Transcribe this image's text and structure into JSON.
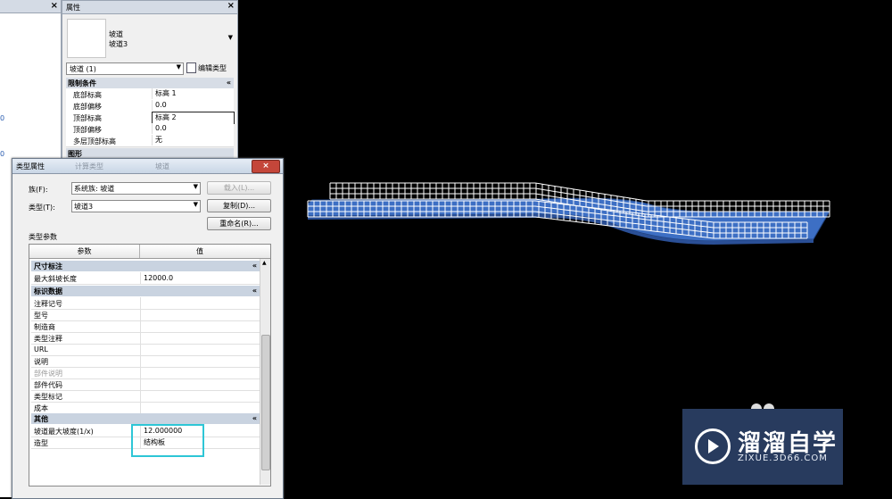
{
  "project_browser": {
    "close_glyph": "×",
    "markers": [
      "0",
      "0"
    ]
  },
  "properties": {
    "title": "属性",
    "close_glyph": "×",
    "type_family": "坡道",
    "type_name": "坡道3",
    "instance_selector": "坡道 (1)",
    "edit_type_label": "编辑类型",
    "sections": [
      {
        "title": "限制条件"
      },
      {
        "title": "图形"
      }
    ],
    "rows": [
      {
        "label": "底部标高",
        "value": "标高 1"
      },
      {
        "label": "底部偏移",
        "value": "0.0"
      },
      {
        "label": "顶部标高",
        "value": "标高 2"
      },
      {
        "label": "顶部偏移",
        "value": "0.0"
      },
      {
        "label": "多层顶部标高",
        "value": "无"
      }
    ]
  },
  "type_dialog": {
    "title": "类型属性",
    "title_ghost_1": "计算类型",
    "title_ghost_2": "坡道",
    "close_glyph": "×",
    "family_label": "族(F):",
    "family_value": "系统族: 坡道",
    "type_label": "类型(T):",
    "type_value": "坡道3",
    "load_button": "载入(L)...",
    "duplicate_button": "复制(D)...",
    "rename_button": "重命名(R)...",
    "params_label": "类型参数",
    "col_param": "参数",
    "col_value": "值",
    "sections": [
      {
        "title": "尺寸标注"
      },
      {
        "title": "标识数据"
      },
      {
        "title": "其他"
      }
    ],
    "dim_rows": [
      {
        "label": "最大斜坡长度",
        "value": "12000.0"
      }
    ],
    "id_rows": [
      {
        "label": "注释记号",
        "value": ""
      },
      {
        "label": "型号",
        "value": ""
      },
      {
        "label": "制造商",
        "value": ""
      },
      {
        "label": "类型注释",
        "value": ""
      },
      {
        "label": "URL",
        "value": ""
      },
      {
        "label": "说明",
        "value": ""
      },
      {
        "label": "部件说明",
        "value": ""
      },
      {
        "label": "部件代码",
        "value": ""
      },
      {
        "label": "类型标记",
        "value": ""
      },
      {
        "label": "成本",
        "value": ""
      }
    ],
    "other_rows": [
      {
        "label": "坡道最大坡度(1/x)",
        "value": "12.000000"
      },
      {
        "label": "造型",
        "value": "结构板"
      }
    ]
  },
  "watermark": {
    "name": "溜溜自学",
    "url": "ZIXUE.3D66.COM"
  },
  "colors": {
    "viewport_bg": "#000000",
    "ramp_fill": "#3d6fc4",
    "railing": "#ffffff",
    "highlight": "#2ec6d6",
    "watermark_bg": "#283b5e"
  }
}
